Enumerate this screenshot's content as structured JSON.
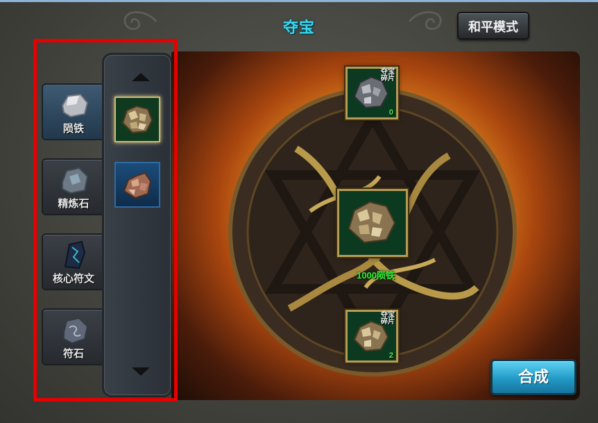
{
  "title": "夺宝",
  "peace_mode_label": "和平模式",
  "categories": [
    {
      "label": "陨铁",
      "icon": "meteorite-icon",
      "active": true
    },
    {
      "label": "精炼石",
      "icon": "refining-stone-icon",
      "active": false
    },
    {
      "label": "核心符文",
      "icon": "core-rune-icon",
      "active": false
    },
    {
      "label": "符石",
      "icon": "rune-stone-icon",
      "active": false
    }
  ],
  "item_list": [
    {
      "icon": "meteorite-ore-icon",
      "selected": true
    },
    {
      "icon": "copper-ore-icon",
      "selected": false
    }
  ],
  "craft": {
    "top_fragment": {
      "label": "夺宝碎片",
      "count": "0"
    },
    "bottom_fragment": {
      "label": "夺宝碎片",
      "count": "2"
    },
    "result_label": "1000陨铁",
    "synthesize_label": "合成"
  },
  "colors": {
    "title": "#39d8f0",
    "count": "#4ff04f",
    "result_label": "#3bea3b",
    "highlight_box": "#e60000",
    "synthesize_button": "#229ac7"
  }
}
